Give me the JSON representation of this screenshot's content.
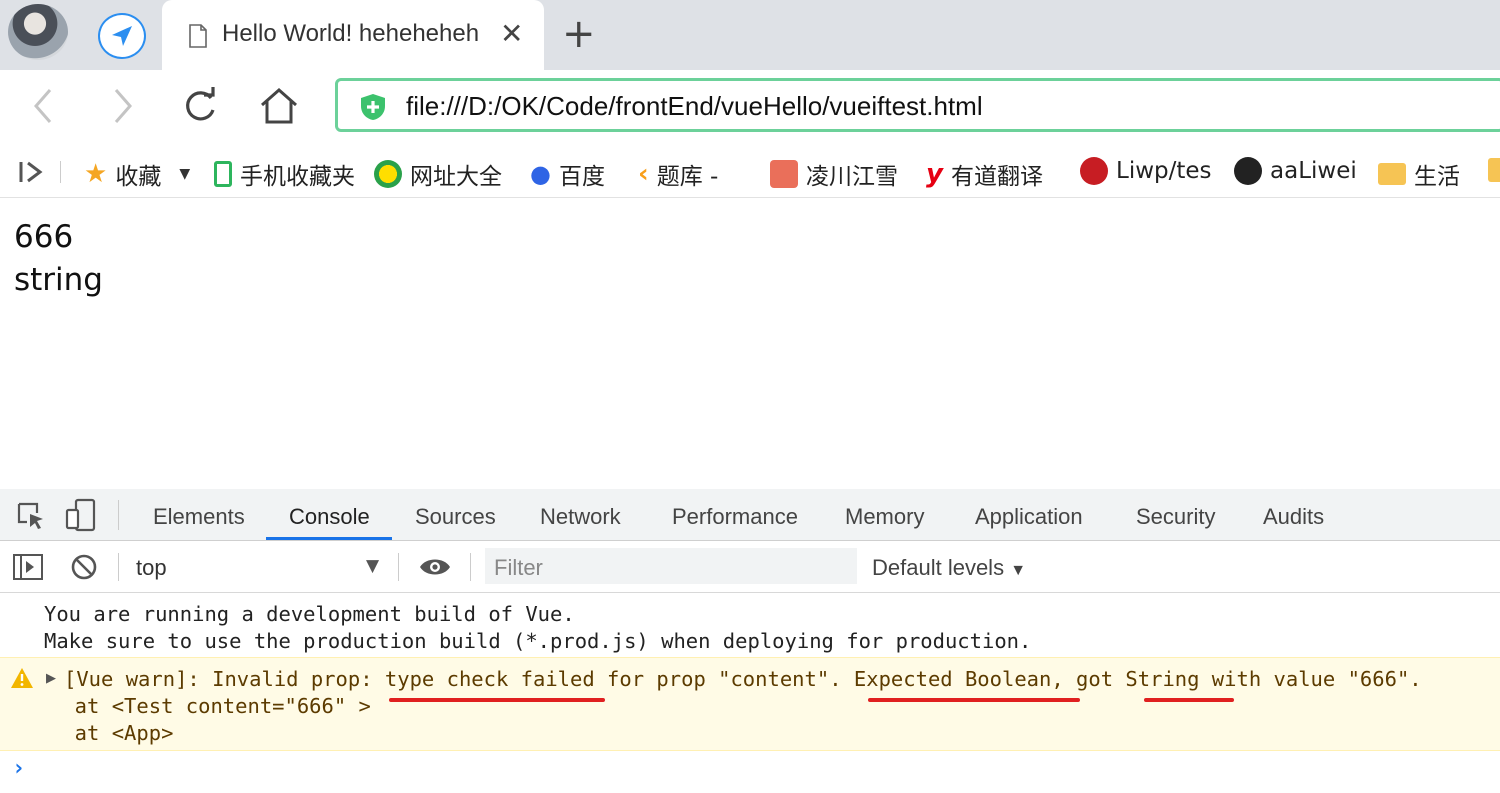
{
  "browser": {
    "tab_title": "Hello World! heheheheh",
    "address_url": "file:///D:/OK/Code/frontEnd/vueHello/vueiftest.html",
    "bookmarks": [
      {
        "label": "收藏",
        "icon": "star-icon"
      },
      {
        "label": "手机收藏夹",
        "icon": "phone-icon"
      },
      {
        "label": "网址大全",
        "icon": "plus-circle-icon"
      },
      {
        "label": "百度",
        "icon": "paw-icon"
      },
      {
        "label": "题库 -",
        "icon": "leetcode-icon"
      },
      {
        "label": "凌川江雪",
        "icon": "jianshu-icon"
      },
      {
        "label": "有道翻译",
        "icon": "youdao-icon"
      },
      {
        "label": "Liwp/tes",
        "icon": "gitee-icon"
      },
      {
        "label": "aaLiwei",
        "icon": "github-icon"
      },
      {
        "label": "生活",
        "icon": "folder-icon"
      }
    ]
  },
  "page": {
    "line1": "666",
    "line2": "string"
  },
  "devtools": {
    "tabs": [
      "Elements",
      "Console",
      "Sources",
      "Network",
      "Performance",
      "Memory",
      "Application",
      "Security",
      "Audits"
    ],
    "active_tab": "Console",
    "context": "top",
    "filter_placeholder": "Filter",
    "levels": "Default levels",
    "console": {
      "info_line1": "You are running a development build of Vue.",
      "info_line2": "Make sure to use the production build (*.prod.js) when deploying for production.",
      "warn_line1": "[Vue warn]: Invalid prop: type check failed for prop \"content\". Expected Boolean, got String with value \"666\".",
      "warn_line2": "  at <Test content=\"666\" >",
      "warn_line3": "  at <App>"
    }
  },
  "colors": {
    "address_border": "#6cd19a",
    "active_tab_underline": "#1a73e8",
    "warning_background": "#fffbe6",
    "annotation_red": "#e02020"
  }
}
